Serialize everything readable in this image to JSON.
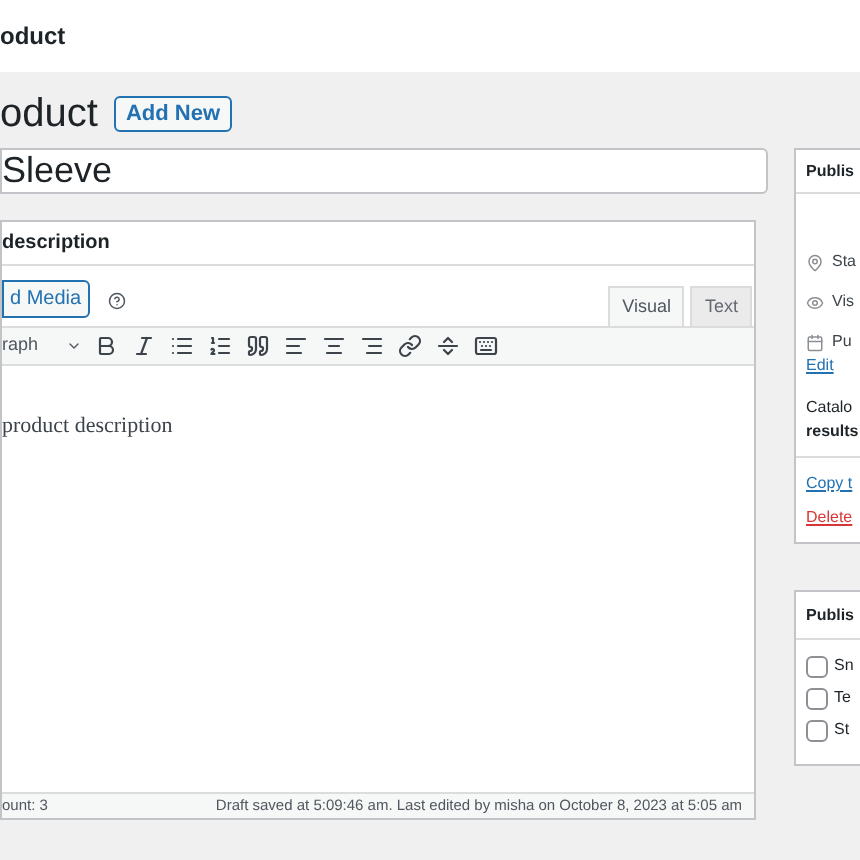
{
  "top_bar": {
    "title": "oduct"
  },
  "heading": {
    "title": "oduct",
    "add_new": "Add New"
  },
  "title_field": {
    "value": "Sleeve"
  },
  "description_box": {
    "title": "description",
    "add_media": "d Media",
    "tabs": [
      {
        "label": "Visual",
        "selected": true
      },
      {
        "label": "Text",
        "selected": false
      }
    ],
    "format_select": "raph",
    "content": "product description",
    "word_count": "ount: 3",
    "draft_status": "Draft saved at 5:09:46 am. Last edited by misha on October 8, 2023 at 5:05 am"
  },
  "publish_box": {
    "title": "Publis",
    "rows": [
      {
        "kind": "pin",
        "label": "Sta"
      },
      {
        "kind": "eye",
        "label": "Vis"
      },
      {
        "kind": "calendar",
        "label": "Pu"
      }
    ],
    "edit_link": "Edit",
    "catalog_label": "Catalo",
    "catalog_value": "results",
    "copy_link": "Copy t",
    "delete_link": "Delete"
  },
  "second_box": {
    "title": "Publis",
    "options": [
      {
        "label": "Sn",
        "checked": false
      },
      {
        "label": "Te",
        "checked": false
      },
      {
        "label": "St",
        "checked": false
      }
    ]
  }
}
